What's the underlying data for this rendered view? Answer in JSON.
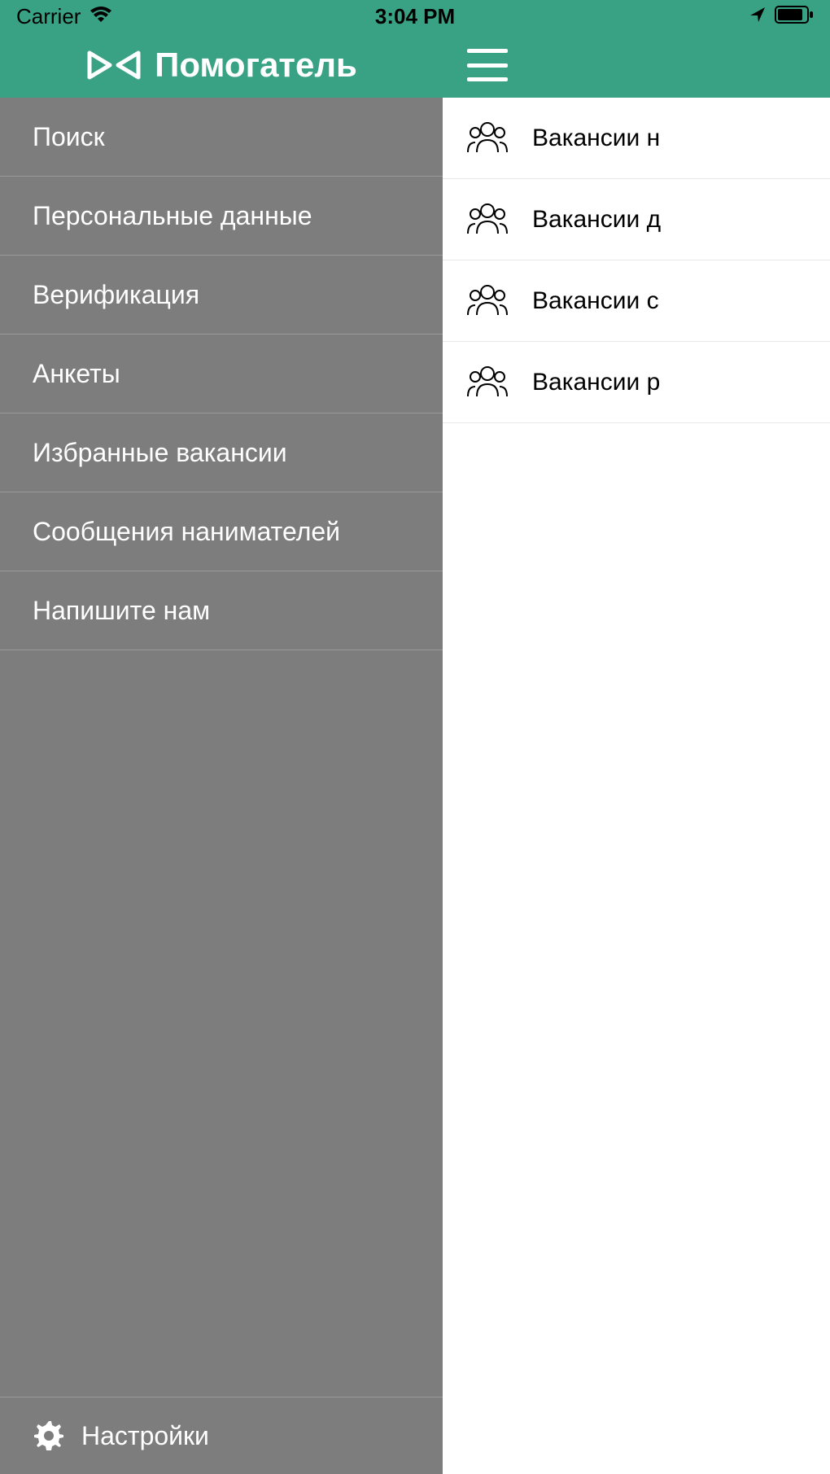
{
  "status_bar": {
    "carrier": "Carrier",
    "time": "3:04 PM"
  },
  "sidebar": {
    "app_title": "Помогатель",
    "items": [
      {
        "label": "Поиск"
      },
      {
        "label": "Персональные данные"
      },
      {
        "label": "Верификация"
      },
      {
        "label": "Анкеты"
      },
      {
        "label": "Избранные вакансии"
      },
      {
        "label": "Сообщения нанимателей"
      },
      {
        "label": "Напишите нам"
      }
    ],
    "settings_label": "Настройки"
  },
  "content": {
    "items": [
      {
        "label": "Вакансии н"
      },
      {
        "label": "Вакансии д"
      },
      {
        "label": "Вакансии с"
      },
      {
        "label": "Вакансии р"
      }
    ]
  }
}
